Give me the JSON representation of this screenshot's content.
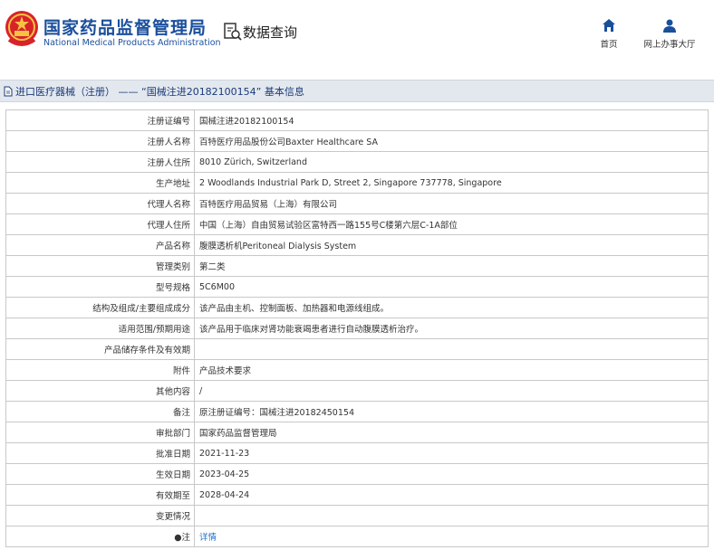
{
  "header": {
    "site_title_cn": "国家药品监督管理局",
    "site_title_en": "National Medical Products Administration",
    "query_label": "数据查询",
    "nav": [
      {
        "label": "首页",
        "icon": "home-icon"
      },
      {
        "label": "网上办事大厅",
        "icon": "user-icon"
      }
    ]
  },
  "breadcrumb": {
    "text": "进口医疗器械（注册） —— “国械注进20182100154” 基本信息"
  },
  "rows": [
    {
      "label": "注册证编号",
      "value": "国械注进20182100154"
    },
    {
      "label": "注册人名称",
      "value": "百特医疗用品股份公司Baxter Healthcare SA"
    },
    {
      "label": "注册人住所",
      "value": "8010 Zürich, Switzerland"
    },
    {
      "label": "生产地址",
      "value": "2 Woodlands Industrial Park D, Street 2, Singapore 737778, Singapore"
    },
    {
      "label": "代理人名称",
      "value": "百特医疗用品贸易（上海）有限公司"
    },
    {
      "label": "代理人住所",
      "value": "中国（上海）自由贸易试验区富特西一路155号C楼第六层C-1A部位"
    },
    {
      "label": "产品名称",
      "value": "腹膜透析机Peritoneal Dialysis System"
    },
    {
      "label": "管理类别",
      "value": "第二类"
    },
    {
      "label": "型号规格",
      "value": "5C6M00"
    },
    {
      "label": "结构及组成/主要组成成分",
      "value": "该产品由主机、控制面板、加热器和电源线组成。"
    },
    {
      "label": "适用范围/预期用途",
      "value": "该产品用于临床对肾功能衰竭患者进行自动腹膜透析治疗。"
    },
    {
      "label": "产品储存条件及有效期",
      "value": ""
    },
    {
      "label": "附件",
      "value": "产品技术要求"
    },
    {
      "label": "其他内容",
      "value": "/"
    },
    {
      "label": "备注",
      "value": "原注册证编号：国械注进20182450154"
    },
    {
      "label": "审批部门",
      "value": "国家药品监督管理局"
    },
    {
      "label": "批准日期",
      "value": "2021-11-23"
    },
    {
      "label": "生效日期",
      "value": "2023-04-25"
    },
    {
      "label": "有效期至",
      "value": "2028-04-24"
    },
    {
      "label": "变更情况",
      "value": ""
    },
    {
      "label": "●注",
      "value": "详情",
      "link": true
    }
  ],
  "colors": {
    "brand_blue": "#1a4f9c",
    "link_blue": "#1a6fd0",
    "breadcrumb_bg": "#e3e8ee"
  }
}
